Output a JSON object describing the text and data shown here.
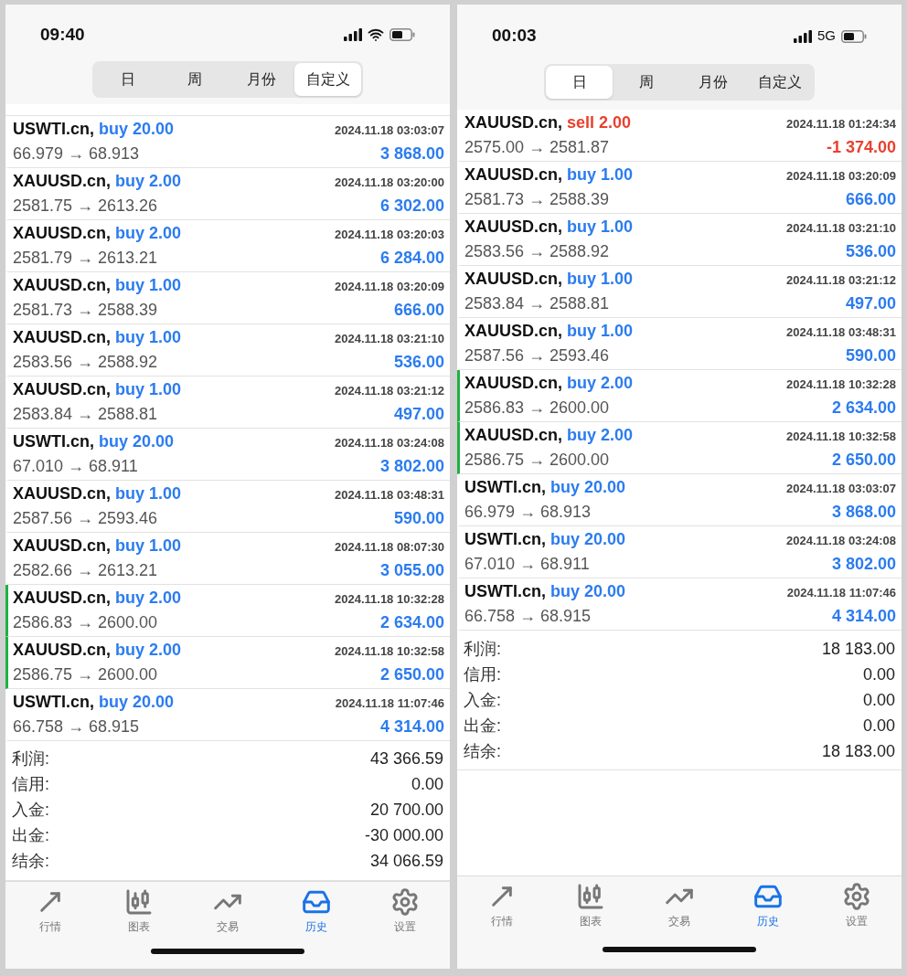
{
  "phones": [
    {
      "status": {
        "time": "09:40",
        "kind": "wifi"
      },
      "tabs": [
        {
          "label": "日",
          "selected": false
        },
        {
          "label": "周",
          "selected": false
        },
        {
          "label": "月份",
          "selected": false
        },
        {
          "label": "自定义",
          "selected": true
        }
      ],
      "clipped_top": true,
      "trades": [
        {
          "symbol": "USWTI.cn,",
          "order": "buy 20.00",
          "kind": "buy",
          "time": "2024.11.18 03:03:07",
          "prices": "66.979 → 68.913",
          "profit": "3 868.00",
          "marked": false
        },
        {
          "symbol": "XAUUSD.cn,",
          "order": "buy 2.00",
          "kind": "buy",
          "time": "2024.11.18 03:20:00",
          "prices": "2581.75 → 2613.26",
          "profit": "6 302.00",
          "marked": false
        },
        {
          "symbol": "XAUUSD.cn,",
          "order": "buy 2.00",
          "kind": "buy",
          "time": "2024.11.18 03:20:03",
          "prices": "2581.79 → 2613.21",
          "profit": "6 284.00",
          "marked": false
        },
        {
          "symbol": "XAUUSD.cn,",
          "order": "buy 1.00",
          "kind": "buy",
          "time": "2024.11.18 03:20:09",
          "prices": "2581.73 → 2588.39",
          "profit": "666.00",
          "marked": false
        },
        {
          "symbol": "XAUUSD.cn,",
          "order": "buy 1.00",
          "kind": "buy",
          "time": "2024.11.18 03:21:10",
          "prices": "2583.56 → 2588.92",
          "profit": "536.00",
          "marked": false
        },
        {
          "symbol": "XAUUSD.cn,",
          "order": "buy 1.00",
          "kind": "buy",
          "time": "2024.11.18 03:21:12",
          "prices": "2583.84 → 2588.81",
          "profit": "497.00",
          "marked": false
        },
        {
          "symbol": "USWTI.cn,",
          "order": "buy 20.00",
          "kind": "buy",
          "time": "2024.11.18 03:24:08",
          "prices": "67.010 → 68.911",
          "profit": "3 802.00",
          "marked": false
        },
        {
          "symbol": "XAUUSD.cn,",
          "order": "buy 1.00",
          "kind": "buy",
          "time": "2024.11.18 03:48:31",
          "prices": "2587.56 → 2593.46",
          "profit": "590.00",
          "marked": false
        },
        {
          "symbol": "XAUUSD.cn,",
          "order": "buy 1.00",
          "kind": "buy",
          "time": "2024.11.18 08:07:30",
          "prices": "2582.66 → 2613.21",
          "profit": "3 055.00",
          "marked": false
        },
        {
          "symbol": "XAUUSD.cn,",
          "order": "buy 2.00",
          "kind": "buy",
          "time": "2024.11.18 10:32:28",
          "prices": "2586.83 → 2600.00",
          "profit": "2 634.00",
          "marked": true
        },
        {
          "symbol": "XAUUSD.cn,",
          "order": "buy 2.00",
          "kind": "buy",
          "time": "2024.11.18 10:32:58",
          "prices": "2586.75 → 2600.00",
          "profit": "2 650.00",
          "marked": true
        },
        {
          "symbol": "USWTI.cn,",
          "order": "buy 20.00",
          "kind": "buy",
          "time": "2024.11.18 11:07:46",
          "prices": "66.758 → 68.915",
          "profit": "4 314.00",
          "marked": false
        }
      ],
      "summary": [
        {
          "label": "利润:",
          "value": "43 366.59"
        },
        {
          "label": "信用:",
          "value": "0.00"
        },
        {
          "label": "入金:",
          "value": "20 700.00"
        },
        {
          "label": "出金:",
          "value": "-30 000.00"
        },
        {
          "label": "结余:",
          "value": "34 066.59"
        }
      ],
      "nav": [
        {
          "label": "行情",
          "selected": false
        },
        {
          "label": "图表",
          "selected": false
        },
        {
          "label": "交易",
          "selected": false
        },
        {
          "label": "历史",
          "selected": true
        },
        {
          "label": "设置",
          "selected": false
        }
      ]
    },
    {
      "status": {
        "time": "00:03",
        "kind": "cellular",
        "network_label": "5G"
      },
      "tabs": [
        {
          "label": "日",
          "selected": true
        },
        {
          "label": "周",
          "selected": false
        },
        {
          "label": "月份",
          "selected": false
        },
        {
          "label": "自定义",
          "selected": false
        }
      ],
      "clipped_top": false,
      "trades": [
        {
          "symbol": "XAUUSD.cn,",
          "order": "sell 2.00",
          "kind": "sell",
          "time": "2024.11.18 01:24:34",
          "prices": "2575.00 → 2581.87",
          "profit": "-1 374.00",
          "marked": false
        },
        {
          "symbol": "XAUUSD.cn,",
          "order": "buy 1.00",
          "kind": "buy",
          "time": "2024.11.18 03:20:09",
          "prices": "2581.73 → 2588.39",
          "profit": "666.00",
          "marked": false
        },
        {
          "symbol": "XAUUSD.cn,",
          "order": "buy 1.00",
          "kind": "buy",
          "time": "2024.11.18 03:21:10",
          "prices": "2583.56 → 2588.92",
          "profit": "536.00",
          "marked": false
        },
        {
          "symbol": "XAUUSD.cn,",
          "order": "buy 1.00",
          "kind": "buy",
          "time": "2024.11.18 03:21:12",
          "prices": "2583.84 → 2588.81",
          "profit": "497.00",
          "marked": false
        },
        {
          "symbol": "XAUUSD.cn,",
          "order": "buy 1.00",
          "kind": "buy",
          "time": "2024.11.18 03:48:31",
          "prices": "2587.56 → 2593.46",
          "profit": "590.00",
          "marked": false
        },
        {
          "symbol": "XAUUSD.cn,",
          "order": "buy 2.00",
          "kind": "buy",
          "time": "2024.11.18 10:32:28",
          "prices": "2586.83 → 2600.00",
          "profit": "2 634.00",
          "marked": true
        },
        {
          "symbol": "XAUUSD.cn,",
          "order": "buy 2.00",
          "kind": "buy",
          "time": "2024.11.18 10:32:58",
          "prices": "2586.75 → 2600.00",
          "profit": "2 650.00",
          "marked": true
        },
        {
          "symbol": "USWTI.cn,",
          "order": "buy 20.00",
          "kind": "buy",
          "time": "2024.11.18 03:03:07",
          "prices": "66.979 → 68.913",
          "profit": "3 868.00",
          "marked": false
        },
        {
          "symbol": "USWTI.cn,",
          "order": "buy 20.00",
          "kind": "buy",
          "time": "2024.11.18 03:24:08",
          "prices": "67.010 → 68.911",
          "profit": "3 802.00",
          "marked": false
        },
        {
          "symbol": "USWTI.cn,",
          "order": "buy 20.00",
          "kind": "buy",
          "time": "2024.11.18 11:07:46",
          "prices": "66.758 → 68.915",
          "profit": "4 314.00",
          "marked": false
        }
      ],
      "summary": [
        {
          "label": "利润:",
          "value": "18 183.00"
        },
        {
          "label": "信用:",
          "value": "0.00"
        },
        {
          "label": "入金:",
          "value": "0.00"
        },
        {
          "label": "出金:",
          "value": "0.00"
        },
        {
          "label": "结余:",
          "value": "18 183.00"
        }
      ],
      "nav": [
        {
          "label": "行情",
          "selected": false
        },
        {
          "label": "图表",
          "selected": false
        },
        {
          "label": "交易",
          "selected": false
        },
        {
          "label": "历史",
          "selected": true
        },
        {
          "label": "设置",
          "selected": false
        }
      ]
    }
  ]
}
